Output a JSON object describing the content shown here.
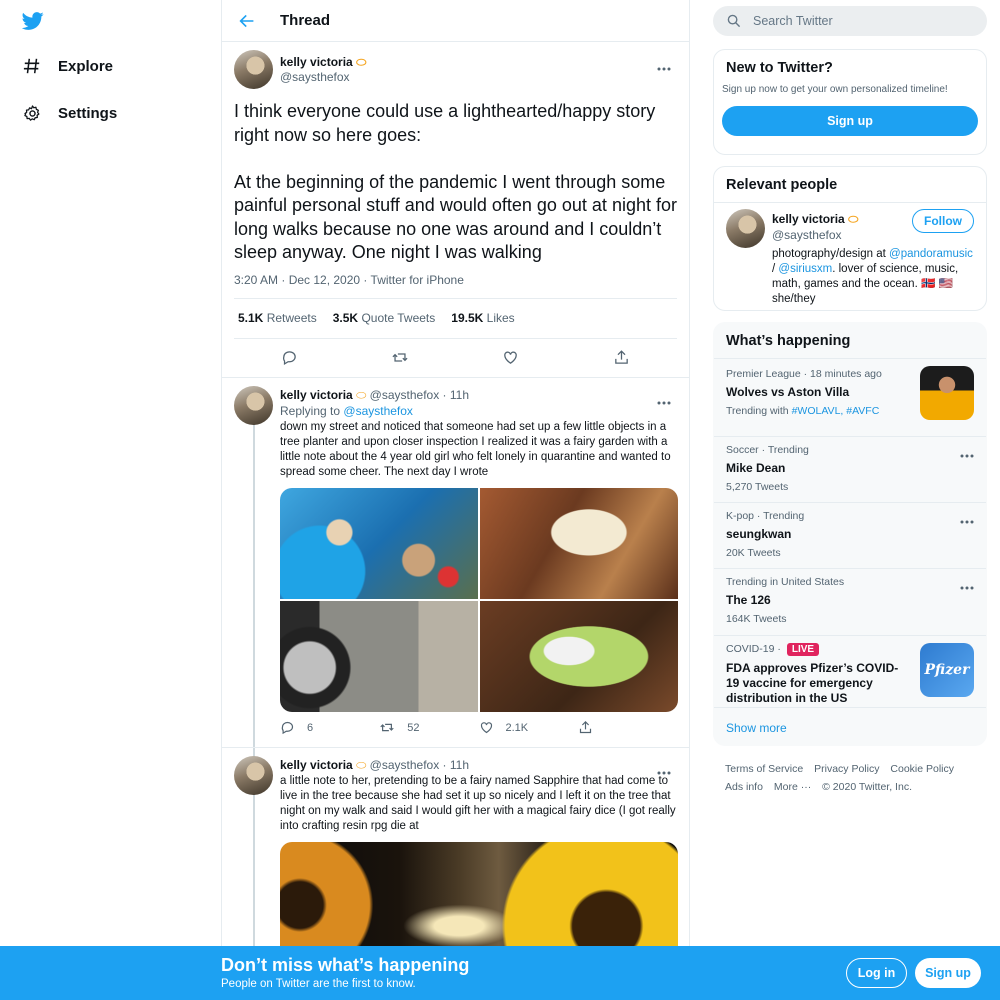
{
  "nav": {
    "items": [
      {
        "label": "Explore",
        "icon": "hashtag-icon"
      },
      {
        "label": "Settings",
        "icon": "gear-icon"
      }
    ]
  },
  "thread": {
    "title": "Thread",
    "main": {
      "name": "kelly victoria",
      "handle": "@saysthefox",
      "text": "I think everyone could use a lighthearted/happy story right now so here goes:\n\nAt the beginning of the pandemic I went through some painful personal stuff and would often go out at night for long walks because no one was around and I couldn’t sleep anyway. One night I was walking",
      "meta": "3:20 AM · Dec 12, 2020 · Twitter for iPhone",
      "retweets": "5.1K",
      "retweets_label": "Retweets",
      "quotes": "3.5K",
      "quotes_label": "Quote Tweets",
      "likes": "19.5K",
      "likes_label": "Likes"
    },
    "replies": [
      {
        "name": "kelly victoria",
        "handle": "@saysthefox",
        "time": "· 11h",
        "replying_prefix": "Replying to",
        "replying_to": "@saysthefox",
        "text": "down my street and noticed that someone had set up a few little objects in a tree planter and upon closer inspection I realized it was a fairy garden with a little note about the 4 year old girl who felt lonely in quarantine and wanted to spread some cheer. The next day I wrote",
        "reply_count": "6",
        "retweet_count": "52",
        "like_count": "2.1K"
      },
      {
        "name": "kelly victoria",
        "handle": "@saysthefox",
        "time": "· 11h",
        "text": "a little note to her, pretending to be a fairy named Sapphire that had come to live in the tree because she had set it up so nicely and I left it on the tree that night on my walk and said I would gift her with a magical fairy dice (I got really into crafting resin rpg die at"
      }
    ]
  },
  "search": {
    "placeholder": "Search Twitter"
  },
  "new_to_twitter": {
    "title": "New to Twitter?",
    "subtitle": "Sign up now to get your own personalized timeline!",
    "button": "Sign up"
  },
  "relevant": {
    "title": "Relevant people",
    "name": "kelly victoria",
    "handle": "@saysthefox",
    "follow": "Follow",
    "bio_1": "photography/design at",
    "bio_link1": "@pandoramusic",
    "bio_sep": " / ",
    "bio_link2": "@siriusxm",
    "bio_2": ". lover of science, music, math, games and the ocean. 🇳🇴 🇺🇸 she/they"
  },
  "happening": {
    "title": "What’s happening",
    "trends": [
      {
        "category": "Premier League · 18 minutes ago",
        "title": "Wolves vs Aston Villa",
        "sub_prefix": "Trending with",
        "sub_links": "#WOLAVL, #AVFC"
      },
      {
        "category": "Soccer · Trending",
        "title": "Mike Dean",
        "sub": "5,270 Tweets"
      },
      {
        "category": "K-pop · Trending",
        "title": "seungkwan",
        "sub": "20K Tweets"
      },
      {
        "category": "Trending in United States",
        "title": "The 126",
        "sub": "164K Tweets"
      },
      {
        "category": "COVID-19 ·",
        "live": "LIVE",
        "title": "FDA approves Pfizer’s COVID-19 vaccine for emergency distribution in the US",
        "image_text": "Pfizer"
      }
    ],
    "show_more": "Show more"
  },
  "footer": {
    "terms": "Terms of Service",
    "privacy": "Privacy Policy",
    "cookie": "Cookie Policy",
    "ads": "Ads info",
    "more": "More ···",
    "copyright": "© 2020 Twitter, Inc."
  },
  "bottom_bar": {
    "title": "Don’t miss what’s happening",
    "subtitle": "People on Twitter are the first to know.",
    "login": "Log in",
    "signup": "Sign up"
  },
  "colors": {
    "accent": "#1da1f2",
    "link": "#1b95e0",
    "live": "#e0245e"
  }
}
